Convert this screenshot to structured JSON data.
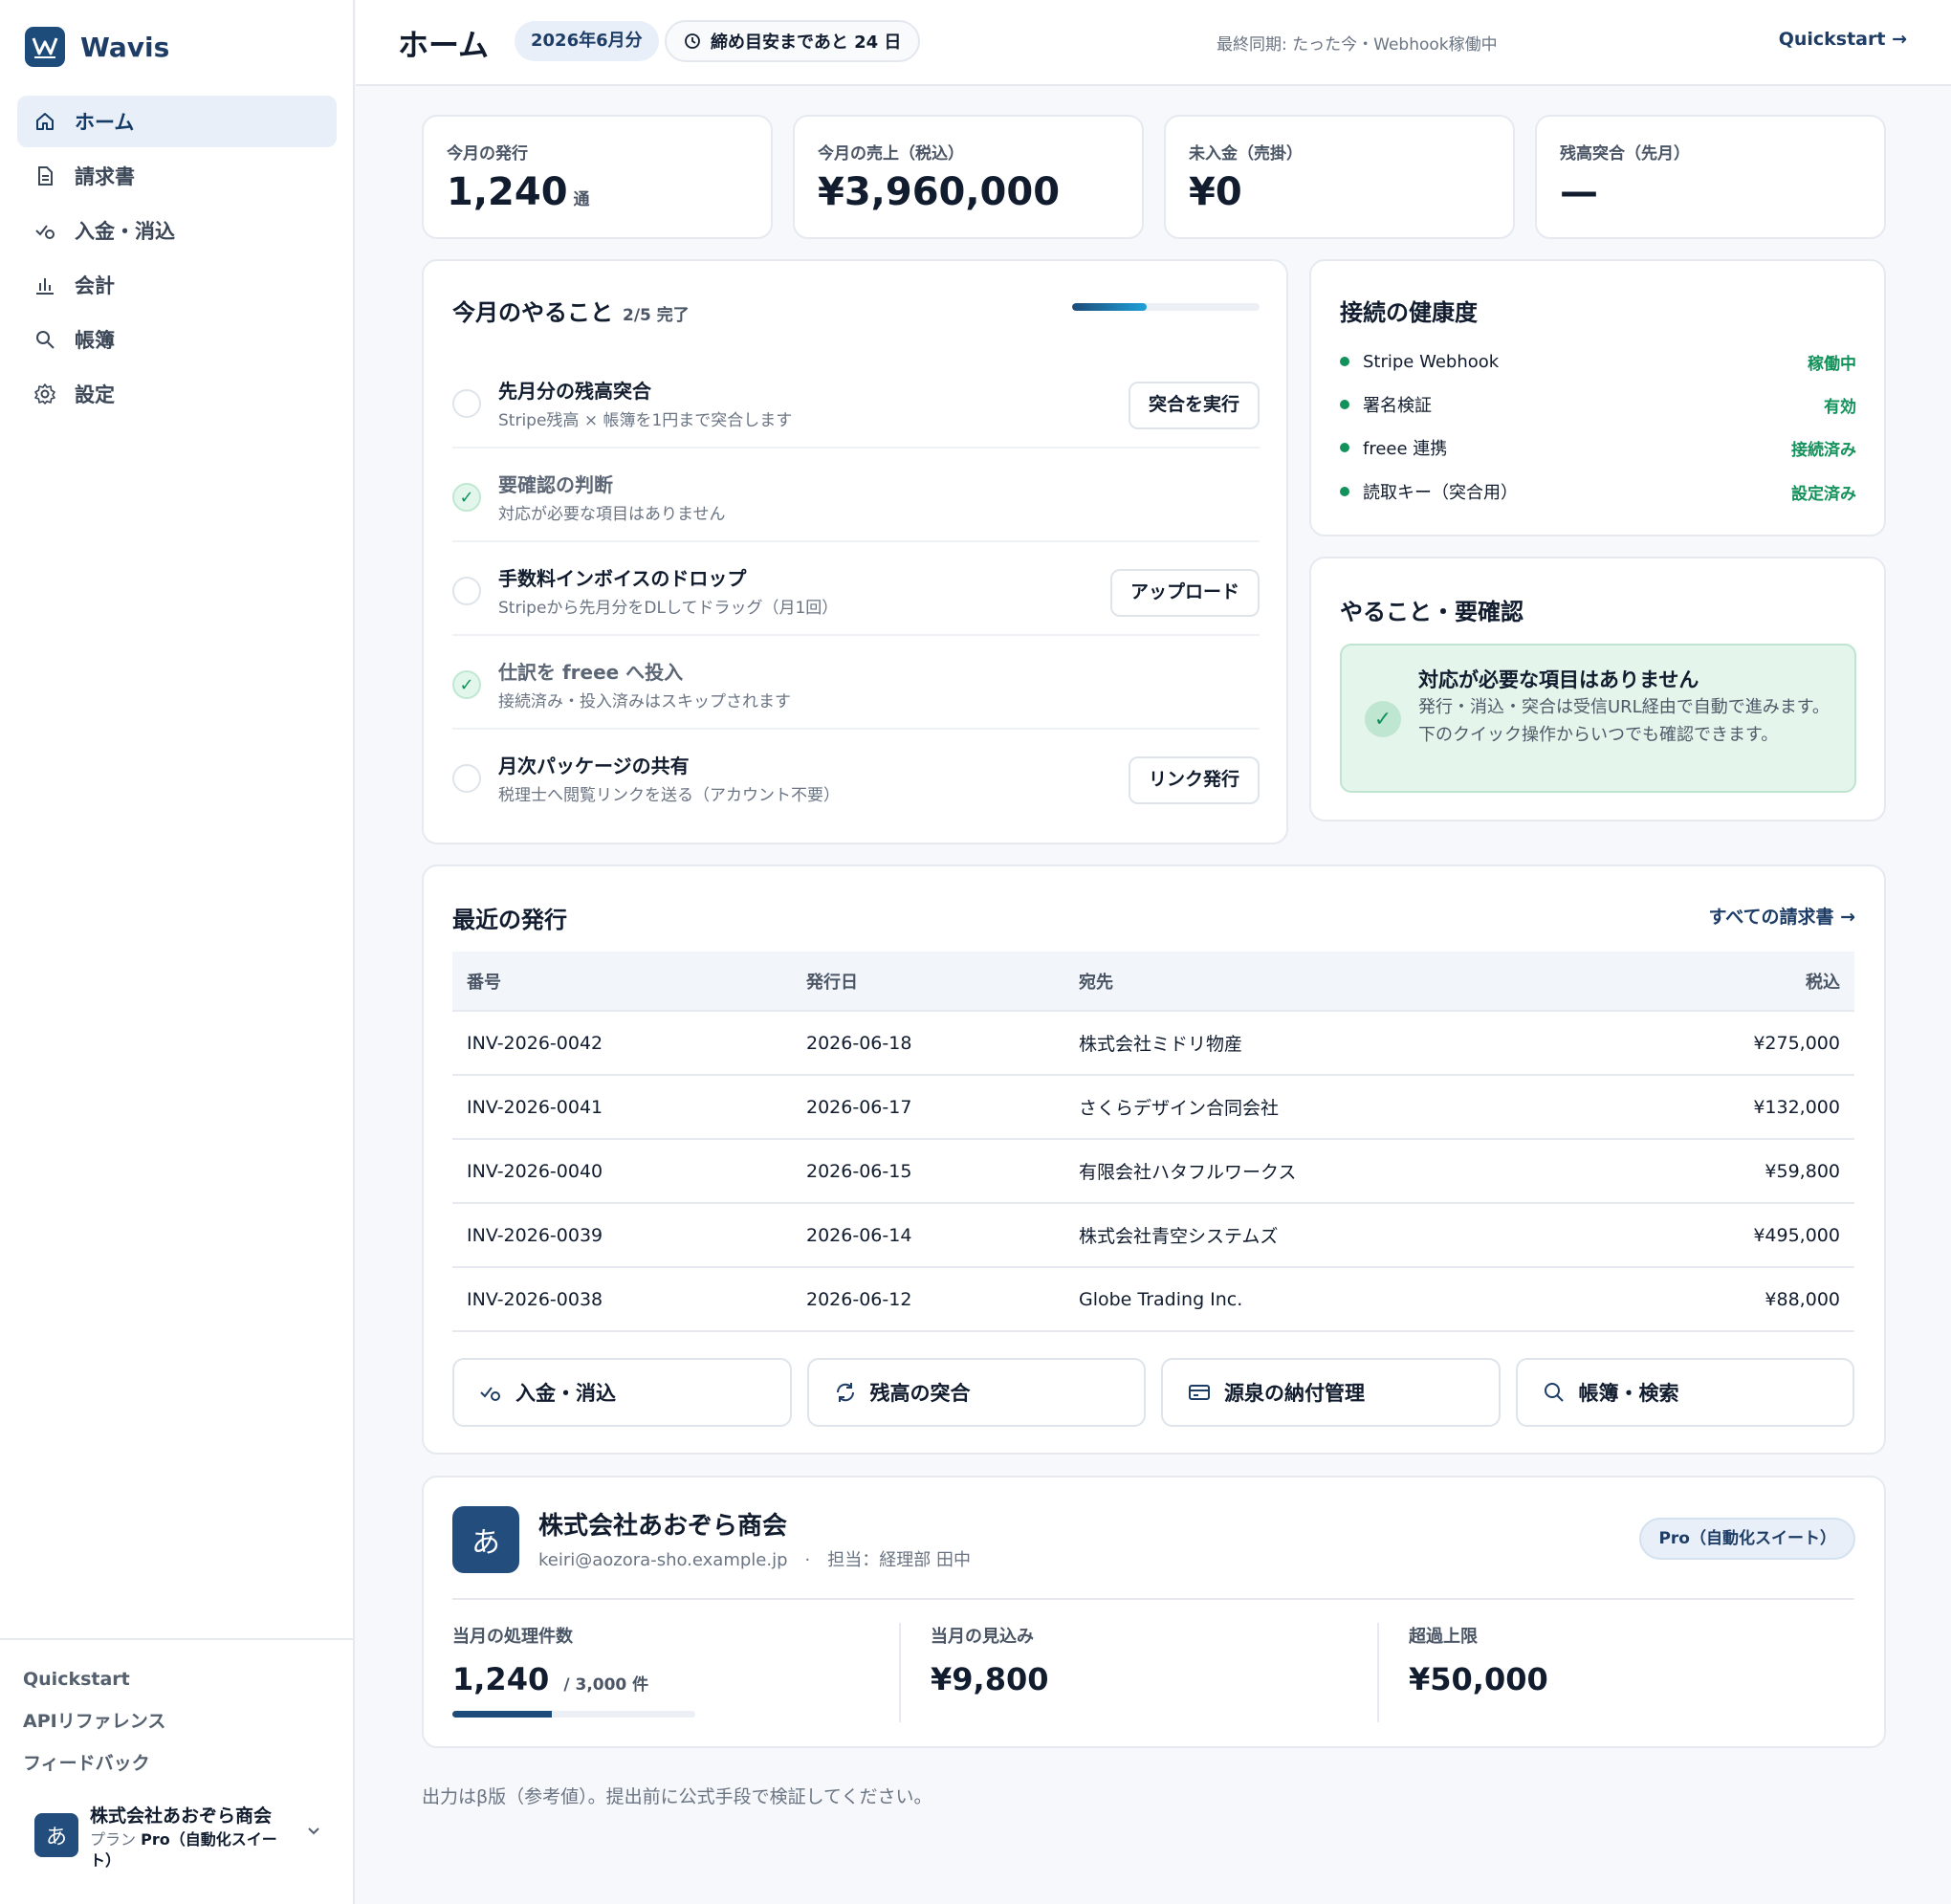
{
  "brand": {
    "name": "Wavis",
    "logo_icon": "w-logo-icon"
  },
  "sidebar": {
    "items": [
      {
        "label": "ホーム",
        "icon": "home-icon",
        "active": true
      },
      {
        "label": "請求書",
        "icon": "document-icon",
        "active": false
      },
      {
        "label": "入金・消込",
        "icon": "payment-check-icon",
        "active": false
      },
      {
        "label": "会計",
        "icon": "bar-chart-icon",
        "active": false
      },
      {
        "label": "帳簿",
        "icon": "search-icon",
        "active": false
      },
      {
        "label": "設定",
        "icon": "gear-icon",
        "active": false
      }
    ],
    "footer_links": [
      "Quickstart",
      "APIリファレンス",
      "フィードバック"
    ],
    "account": {
      "avatar": "あ",
      "name": "株式会社あおぞら商会",
      "plan_prefix": "プラン",
      "plan_name": "Pro（自動化スイート）"
    }
  },
  "topbar": {
    "title": "ホーム",
    "month_pill": "2026年6月分",
    "deadline": "締め目安まであと 24 日",
    "sync": "最終同期: たった今・Webhook稼働中",
    "quickstart": "Quickstart →"
  },
  "stats": [
    {
      "label": "今月の発行",
      "value": "1,240",
      "unit": "通"
    },
    {
      "label": "今月の売上（税込）",
      "value": "¥3,960,000",
      "unit": ""
    },
    {
      "label": "未入金（売掛）",
      "value": "¥0",
      "unit": ""
    },
    {
      "label": "残高突合（先月）",
      "value": "—",
      "unit": ""
    }
  ],
  "tasks": {
    "title": "今月のやること",
    "progress": "2/5 完了",
    "progress_fraction": 0.4,
    "items": [
      {
        "title": "先月分の残高突合",
        "desc": "Stripe残高 × 帳簿を1円まで突合します",
        "done": false,
        "button": "突合を実行"
      },
      {
        "title": "要確認の判断",
        "desc": "対応が必要な項目はありません",
        "done": true,
        "button": ""
      },
      {
        "title": "手数料インボイスのドロップ",
        "desc": "Stripeから先月分をDLしてドラッグ（月1回）",
        "done": false,
        "button": "アップロード"
      },
      {
        "title": "仕訳を freee へ投入",
        "desc": "接続済み・投入済みはスキップされます",
        "done": true,
        "button": ""
      },
      {
        "title": "月次パッケージの共有",
        "desc": "税理士へ閲覧リンクを送る（アカウント不要）",
        "done": false,
        "button": "リンク発行"
      }
    ]
  },
  "health": {
    "title": "接続の健康度",
    "items": [
      {
        "name": "Stripe Webhook",
        "status": "稼働中"
      },
      {
        "name": "署名検証",
        "status": "有効"
      },
      {
        "name": "freee 連携",
        "status": "接続済み"
      },
      {
        "name": "読取キー（突合用）",
        "status": "設定済み"
      }
    ]
  },
  "todo": {
    "title": "やること・要確認",
    "ok_title": "対応が必要な項目はありません",
    "ok_desc": "発行・消込・突合は受信URL経由で自動で進みます。下のクイック操作からいつでも確認できます。"
  },
  "recent": {
    "title": "最近の発行",
    "link": "すべての請求書 →",
    "columns": [
      "番号",
      "発行日",
      "宛先",
      "税込"
    ],
    "rows": [
      [
        "INV-2026-0042",
        "2026-06-18",
        "株式会社ミドリ物産",
        "¥275,000"
      ],
      [
        "INV-2026-0041",
        "2026-06-17",
        "さくらデザイン合同会社",
        "¥132,000"
      ],
      [
        "INV-2026-0040",
        "2026-06-15",
        "有限会社ハタフルワークス",
        "¥59,800"
      ],
      [
        "INV-2026-0039",
        "2026-06-14",
        "株式会社青空システムズ",
        "¥495,000"
      ],
      [
        "INV-2026-0038",
        "2026-06-12",
        "Globe Trading Inc.",
        "¥88,000"
      ]
    ],
    "quick_actions": [
      {
        "label": "入金・消込",
        "icon": "payment-check-icon"
      },
      {
        "label": "残高の突合",
        "icon": "refresh-icon"
      },
      {
        "label": "源泉の納付管理",
        "icon": "card-icon"
      },
      {
        "label": "帳簿・検索",
        "icon": "search-icon"
      }
    ]
  },
  "org": {
    "avatar": "あ",
    "name": "株式会社あおぞら商会",
    "email": "keiri@aozora-sho.example.jp",
    "separator": "·",
    "contact": "担当：経理部 田中",
    "plan": "Pro（自動化スイート）",
    "metrics": [
      {
        "label": "当月の処理件数",
        "value": "1,240",
        "unit": "/ 3,000 件",
        "usage_fraction": 0.41
      },
      {
        "label": "当月の見込み",
        "value": "¥9,800",
        "unit": ""
      },
      {
        "label": "超過上限",
        "value": "¥50,000",
        "unit": ""
      }
    ]
  },
  "footnote": "出力はβ版（参考値）。提出前に公式手段で検証してください。",
  "colors": {
    "primary": "#1d4b7a",
    "success": "#13915a",
    "accent": "#1fa0d8"
  }
}
